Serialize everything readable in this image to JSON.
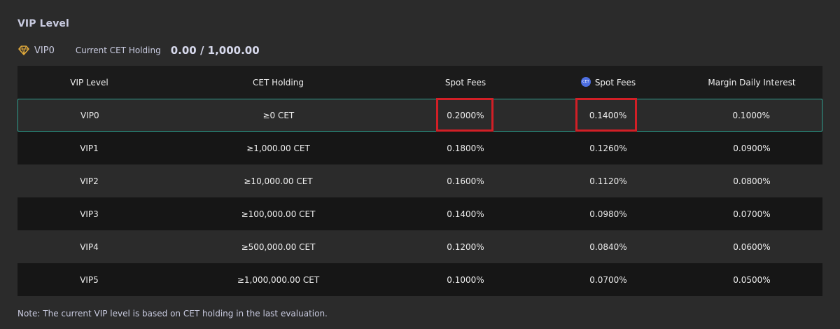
{
  "section_title": "VIP Level",
  "current": {
    "vip": "VIP0",
    "holding_label": "Current CET Holding",
    "holding_value": "0.00 / 1,000.00"
  },
  "table": {
    "headers": [
      "VIP Level",
      "CET Holding",
      "Spot Fees",
      "Spot Fees",
      "Margin Daily Interest"
    ],
    "cet_badge": "CET",
    "rows": [
      [
        "VIP0",
        "≥0 CET",
        "0.2000%",
        "0.1400%",
        "0.1000%"
      ],
      [
        "VIP1",
        "≥1,000.00 CET",
        "0.1800%",
        "0.1260%",
        "0.0900%"
      ],
      [
        "VIP2",
        "≥10,000.00 CET",
        "0.1600%",
        "0.1120%",
        "0.0800%"
      ],
      [
        "VIP3",
        "≥100,000.00 CET",
        "0.1400%",
        "0.0980%",
        "0.0700%"
      ],
      [
        "VIP4",
        "≥500,000.00 CET",
        "0.1200%",
        "0.0840%",
        "0.0600%"
      ],
      [
        "VIP5",
        "≥1,000,000.00 CET",
        "0.1000%",
        "0.0700%",
        "0.0500%"
      ]
    ]
  },
  "note": "Note: The current VIP level is based on CET holding in the last evaluation.",
  "icons": {
    "vip": "diamond-badge-icon",
    "cet": "cet-coin-icon"
  },
  "colors": {
    "background": "#2b2b2b",
    "row_dark": "#161616",
    "header_bg": "#1b1b1b",
    "current_border": "#2f9f8e",
    "highlight": "#d21f26",
    "vip_icon": "#e0a93b",
    "cet_icon": "#4d6ee0"
  }
}
